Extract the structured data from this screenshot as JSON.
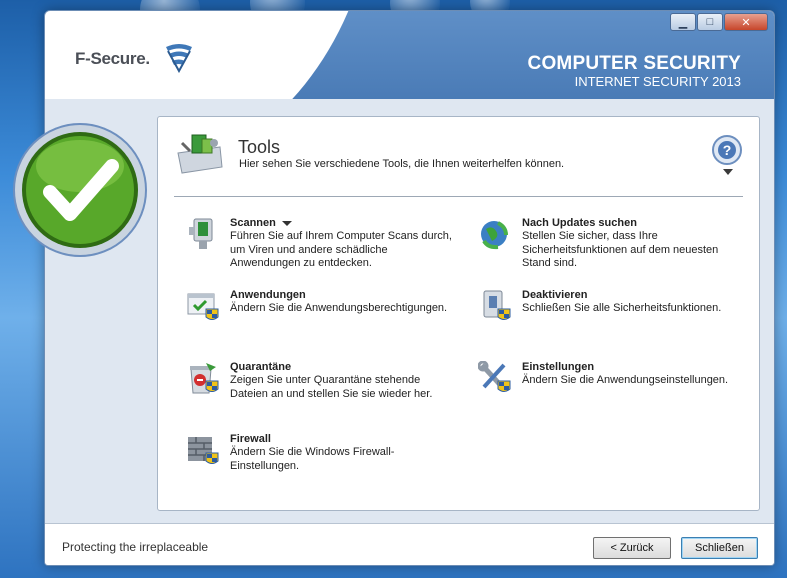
{
  "window": {
    "brand": "F-Secure.",
    "product_title": "COMPUTER SECURITY",
    "product_subtitle": "INTERNET SECURITY 2013",
    "buttons": {
      "minimize": "▁",
      "maximize": "□",
      "close": "✕"
    }
  },
  "status": {
    "icon": "checkmark-icon",
    "color": "#4e9a22"
  },
  "panel": {
    "title": "Tools",
    "subtitle": "Hier sehen Sie verschiedene Tools, die Ihnen weiterhelfen können.",
    "tools": [
      {
        "label": "Scannen",
        "description": "Führen Sie auf Ihrem Computer Scans durch, um Viren und andere schädliche Anwendungen zu entdecken.",
        "icon": "scan-icon",
        "has_dropdown": true
      },
      {
        "label": "Nach Updates suchen",
        "description": "Stellen Sie sicher, dass Ihre Sicherheitsfunktionen auf dem neuesten Stand sind.",
        "icon": "update-globe-icon"
      },
      {
        "label": "Anwendungen",
        "description": "Ändern Sie die Anwendungsberechtigungen.",
        "icon": "applications-icon"
      },
      {
        "label": "Deaktivieren",
        "description": "Schließen Sie alle Sicherheitsfunktionen.",
        "icon": "deactivate-icon"
      },
      {
        "label": "Quarantäne",
        "description": "Zeigen Sie unter Quarantäne stehende Dateien an und stellen Sie sie wieder her.",
        "icon": "quarantine-icon"
      },
      {
        "label": "Einstellungen",
        "description": "Ändern Sie die Anwendungseinstellungen.",
        "icon": "settings-tools-icon"
      },
      {
        "label": "Firewall",
        "description": "Ändern Sie die Windows Firewall-Einstellungen.",
        "icon": "firewall-icon"
      }
    ]
  },
  "footer": {
    "tagline": "Protecting the irreplaceable",
    "back_label": "< Zurück",
    "close_label": "Schließen"
  },
  "colors": {
    "header": "#4a7bb6",
    "accent_green": "#4e9a22",
    "panel_bg": "#ffffff"
  }
}
